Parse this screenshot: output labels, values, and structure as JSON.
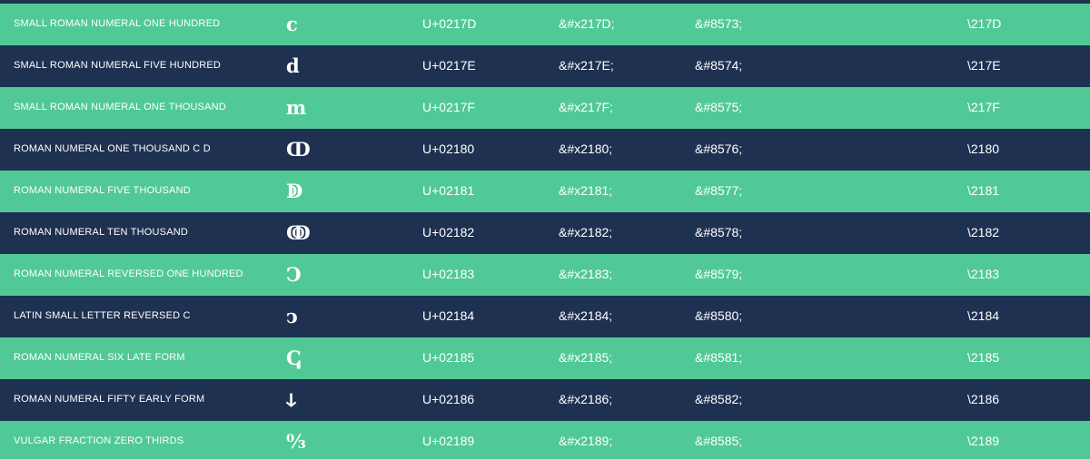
{
  "rows": [
    {
      "name": "SMALL ROMAN NUMERAL ONE HUNDRED",
      "glyph": "ⅽ",
      "code": "U+0217D",
      "hex": "&#x217D;",
      "dec": "&#8573;",
      "css": "\\217D"
    },
    {
      "name": "SMALL ROMAN NUMERAL FIVE HUNDRED",
      "glyph": "ⅾ",
      "code": "U+0217E",
      "hex": "&#x217E;",
      "dec": "&#8574;",
      "css": "\\217E"
    },
    {
      "name": "SMALL ROMAN NUMERAL ONE THOUSAND",
      "glyph": "ⅿ",
      "code": "U+0217F",
      "hex": "&#x217F;",
      "dec": "&#8575;",
      "css": "\\217F"
    },
    {
      "name": "ROMAN NUMERAL ONE THOUSAND C D",
      "glyph": "ↀ",
      "code": "U+02180",
      "hex": "&#x2180;",
      "dec": "&#8576;",
      "css": "\\2180"
    },
    {
      "name": "ROMAN NUMERAL FIVE THOUSAND",
      "glyph": "ↁ",
      "code": "U+02181",
      "hex": "&#x2181;",
      "dec": "&#8577;",
      "css": "\\2181"
    },
    {
      "name": "ROMAN NUMERAL TEN THOUSAND",
      "glyph": "ↂ",
      "code": "U+02182",
      "hex": "&#x2182;",
      "dec": "&#8578;",
      "css": "\\2182"
    },
    {
      "name": "ROMAN NUMERAL REVERSED ONE HUNDRED",
      "glyph": "Ↄ",
      "code": "U+02183",
      "hex": "&#x2183;",
      "dec": "&#8579;",
      "css": "\\2183"
    },
    {
      "name": "LATIN SMALL LETTER REVERSED C",
      "glyph": "ↄ",
      "code": "U+02184",
      "hex": "&#x2184;",
      "dec": "&#8580;",
      "css": "\\2184"
    },
    {
      "name": "ROMAN NUMERAL SIX LATE FORM",
      "glyph": "ↅ",
      "code": "U+02185",
      "hex": "&#x2185;",
      "dec": "&#8581;",
      "css": "\\2185"
    },
    {
      "name": "ROMAN NUMERAL FIFTY EARLY FORM",
      "glyph": "ↆ",
      "code": "U+02186",
      "hex": "&#x2186;",
      "dec": "&#8582;",
      "css": "\\2186"
    },
    {
      "name": "VULGAR FRACTION ZERO THIRDS",
      "glyph": "↉",
      "code": "U+02189",
      "hex": "&#x2189;",
      "dec": "&#8585;",
      "css": "\\2189"
    }
  ],
  "colors": {
    "row_light": "#51c996",
    "row_dark": "#1f3151",
    "text": "#ffffff"
  }
}
